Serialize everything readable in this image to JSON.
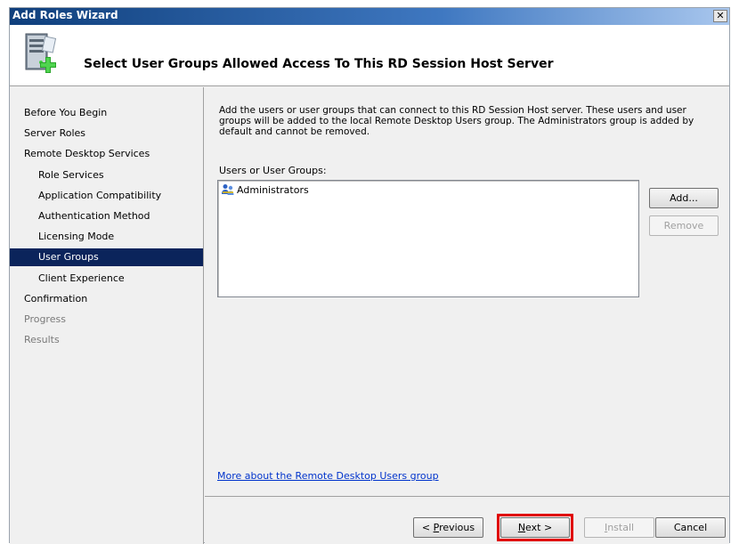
{
  "window": {
    "title": "Add Roles Wizard",
    "close_label": "✕"
  },
  "header": {
    "title": "Select User Groups Allowed Access To This RD Session Host Server",
    "icon": "server-add-icon"
  },
  "nav": {
    "items": [
      {
        "label": "Before You Begin",
        "state": "normal"
      },
      {
        "label": "Server Roles",
        "state": "normal"
      },
      {
        "label": "Remote Desktop Services",
        "state": "normal"
      },
      {
        "label": "Role Services",
        "state": "normal"
      },
      {
        "label": "Application Compatibility",
        "state": "normal"
      },
      {
        "label": "Authentication Method",
        "state": "normal"
      },
      {
        "label": "Licensing Mode",
        "state": "normal"
      },
      {
        "label": "User Groups",
        "state": "selected"
      },
      {
        "label": "Client Experience",
        "state": "normal"
      },
      {
        "label": "Confirmation",
        "state": "normal"
      },
      {
        "label": "Progress",
        "state": "disabled"
      },
      {
        "label": "Results",
        "state": "disabled"
      }
    ]
  },
  "main": {
    "description": "Add the users or user groups that can connect to this RD Session Host server. These users and user groups will be added to the local Remote Desktop Users group. The Administrators group is added by default and cannot be removed.",
    "list_label": "Users or User Groups:",
    "list_items": [
      {
        "label": "Administrators",
        "icon": "user-group-icon"
      }
    ],
    "add_label": "Add...",
    "remove_label": "Remove",
    "link_text": "More about the Remote Desktop Users group"
  },
  "footer": {
    "previous_prefix": "< ",
    "previous_key": "P",
    "previous_rest": "revious",
    "next_key": "N",
    "next_rest": "ext >",
    "install_key": "I",
    "install_rest": "nstall",
    "cancel_label": "Cancel"
  },
  "colors": {
    "selected_nav": "#0b245b",
    "highlight": "#e00000",
    "link": "#0033cc"
  }
}
